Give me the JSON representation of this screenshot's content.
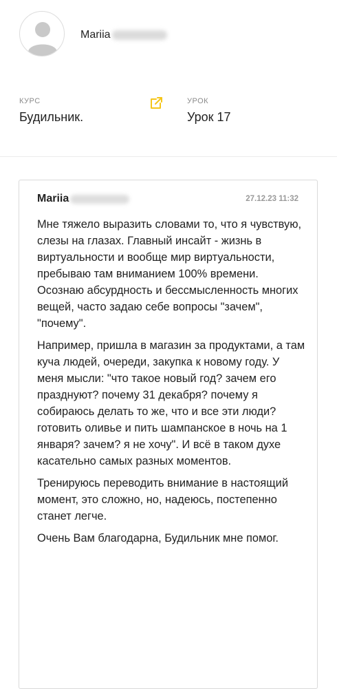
{
  "user": {
    "first_name": "Mariia"
  },
  "meta": {
    "course_label": "КУРС",
    "course_value": "Будильник.",
    "lesson_label": "УРОК",
    "lesson_value": "Урок 17"
  },
  "icons": {
    "avatar": "user-avatar-icon",
    "external": "external-link-icon"
  },
  "colors": {
    "accent": "#f5c518",
    "border": "#d9d9d9",
    "muted": "#8a8a8a"
  },
  "comment": {
    "author_first": "Mariia",
    "date": "27.12.23 11:32",
    "paragraphs": [
      "Мне тяжело выразить словами то, что я чувствую, слезы на глазах. Главный инсайт - жизнь в виртуальности и вообще мир виртуальности, пребываю там вниманием 100% времени. Осознаю абсурдность и бессмысленность многих вещей, часто задаю себе вопросы \"зачем\", \"почему\".",
      "Например, пришла в магазин за продуктами, а там куча людей, очереди, закупка к новому году. У меня мысли: \"что такое новый год? зачем его празднуют? почему 31 декабря? почему я собираюсь делать то же, что и все эти люди? готовить оливье и пить шампанское в ночь на 1 января? зачем? я не хочу\". И всё в таком духе касательно самых разных моментов.",
      "Тренируюсь переводить внимание в настоящий момент, это сложно, но, надеюсь, постепенно станет легче.",
      "Очень Вам благодарна, Будильник мне помог."
    ]
  }
}
